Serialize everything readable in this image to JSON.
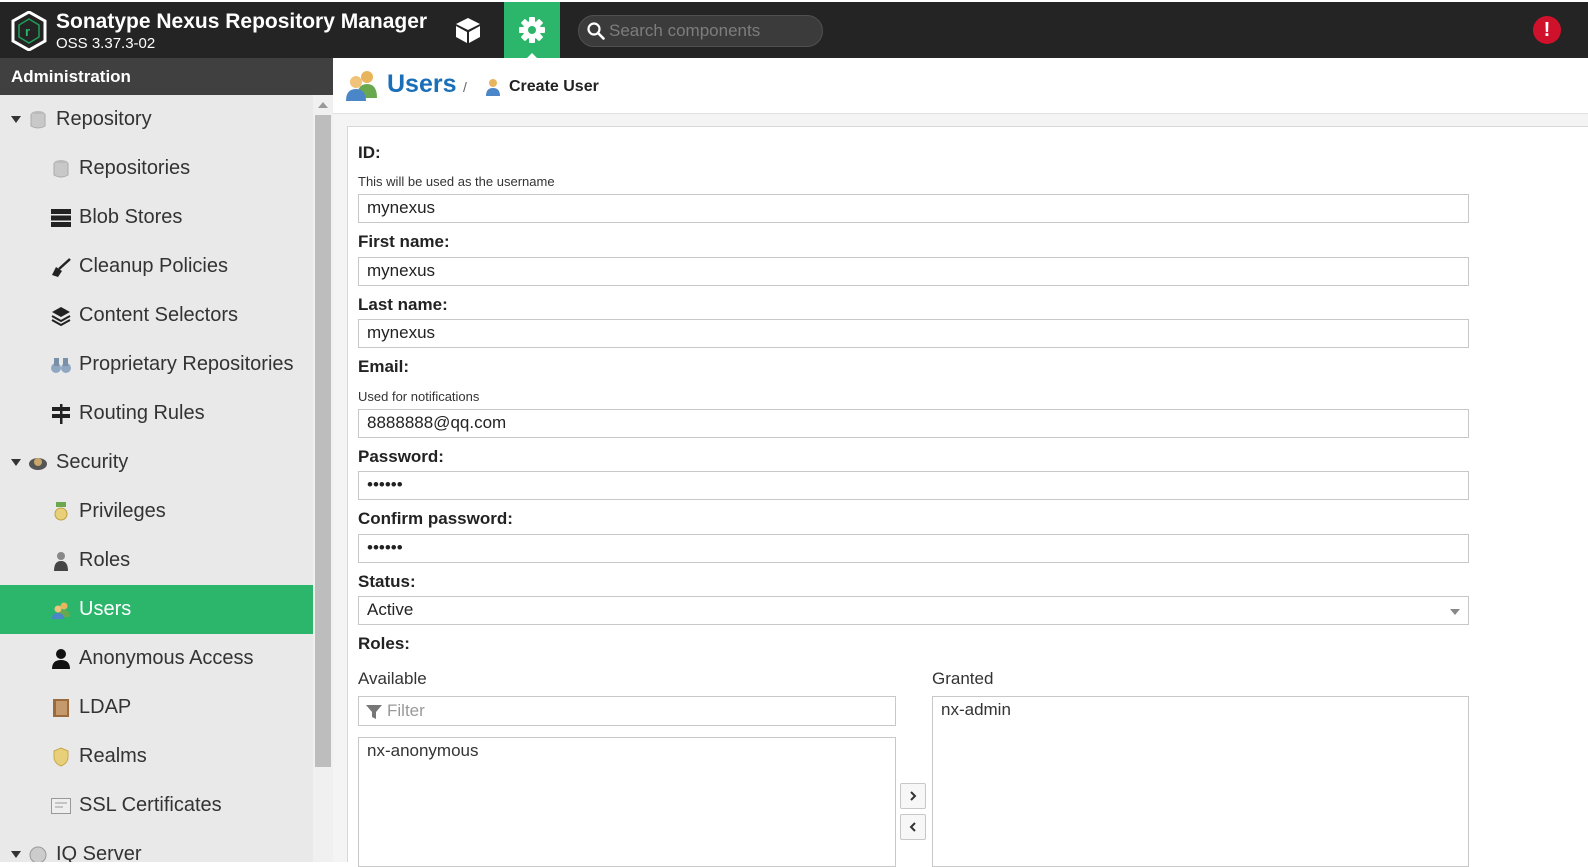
{
  "header": {
    "app_title": "Sonatype Nexus Repository Manager",
    "app_version": "OSS 3.37.3-02",
    "search_placeholder": "Search components",
    "alert_glyph": "!",
    "accent": "#2cb66c"
  },
  "sidebar": {
    "title": "Administration",
    "items": [
      {
        "label": "Repository",
        "icon": "database-icon",
        "kind": "group"
      },
      {
        "label": "Repositories",
        "icon": "database-icon",
        "kind": "child"
      },
      {
        "label": "Blob Stores",
        "icon": "server-icon",
        "kind": "child"
      },
      {
        "label": "Cleanup Policies",
        "icon": "broom-icon",
        "kind": "child"
      },
      {
        "label": "Content Selectors",
        "icon": "layers-icon",
        "kind": "child"
      },
      {
        "label": "Proprietary Repositories",
        "icon": "binoculars-icon",
        "kind": "child"
      },
      {
        "label": "Routing Rules",
        "icon": "signpost-icon",
        "kind": "child"
      },
      {
        "label": "Security",
        "icon": "security-icon",
        "kind": "group"
      },
      {
        "label": "Privileges",
        "icon": "medal-icon",
        "kind": "child"
      },
      {
        "label": "Roles",
        "icon": "role-icon",
        "kind": "child"
      },
      {
        "label": "Users",
        "icon": "users-icon",
        "kind": "child",
        "selected": true
      },
      {
        "label": "Anonymous Access",
        "icon": "user-icon",
        "kind": "child"
      },
      {
        "label": "LDAP",
        "icon": "book-icon",
        "kind": "child"
      },
      {
        "label": "Realms",
        "icon": "shield-icon",
        "kind": "child"
      },
      {
        "label": "SSL Certificates",
        "icon": "certificate-icon",
        "kind": "child"
      },
      {
        "label": "IQ Server",
        "icon": "iq-icon",
        "kind": "group"
      }
    ]
  },
  "breadcrumb": {
    "section": "Users",
    "separator": "/",
    "page": "Create User"
  },
  "form": {
    "id_label": "ID:",
    "id_help": "This will be used as the username",
    "id_value": "mynexus",
    "first_name_label": "First name:",
    "first_name_value": "mynexus",
    "last_name_label": "Last name:",
    "last_name_value": "mynexus",
    "email_label": "Email:",
    "email_help": "Used for notifications",
    "email_value": "8888888@qq.com",
    "password_label": "Password:",
    "password_value": "••••••",
    "confirm_label": "Confirm password:",
    "confirm_value": "••••••",
    "status_label": "Status:",
    "status_value": "Active",
    "roles_label": "Roles:",
    "available_label": "Available",
    "granted_label": "Granted",
    "filter_placeholder": "Filter",
    "available_roles": [
      "nx-anonymous"
    ],
    "granted_roles": [
      "nx-admin"
    ]
  }
}
